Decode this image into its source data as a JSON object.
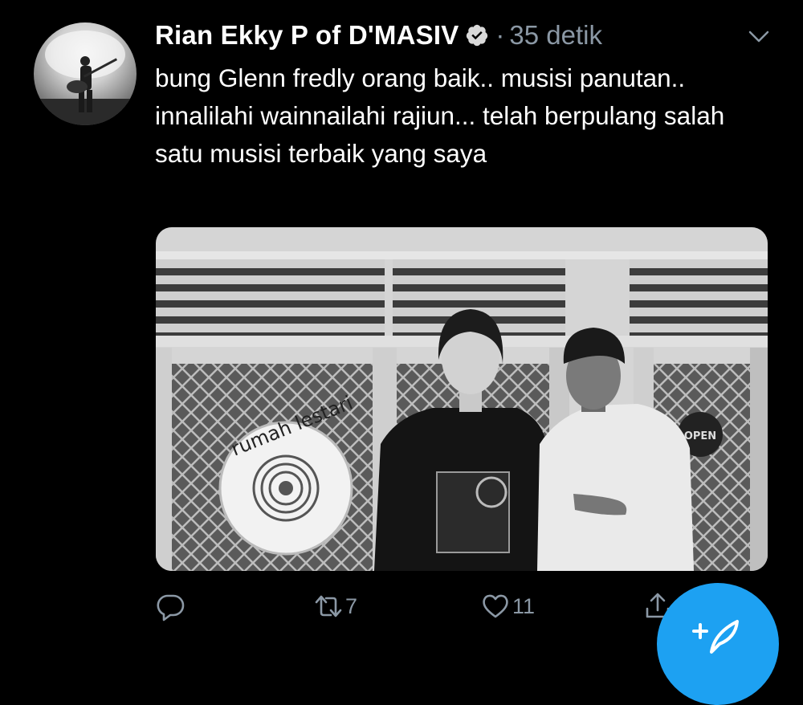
{
  "tweet": {
    "author_name": "Rian Ekky P of D'MASIV",
    "verified": true,
    "separator": "·",
    "timestamp": "35 detik",
    "text": "bung Glenn fredly orang baik.. musisi panutan.. innalilahi wainnailahi rajiun... telah berpulang salah satu musisi terbaik yang saya",
    "photo": {
      "wall_sign_text": "rumah lestari",
      "door_sign_text": "OPEN"
    }
  },
  "actions": {
    "reply_icon": "reply-bubble-icon",
    "retweet_icon": "retweet-icon",
    "retweet_count": "7",
    "like_icon": "heart-icon",
    "like_count": "11",
    "share_icon": "share-icon"
  },
  "fab": {
    "icon": "compose-feather-icon"
  },
  "colors": {
    "background": "#000000",
    "text": "#ffffff",
    "secondary": "#8b98a5",
    "accent": "#1da1f2"
  }
}
